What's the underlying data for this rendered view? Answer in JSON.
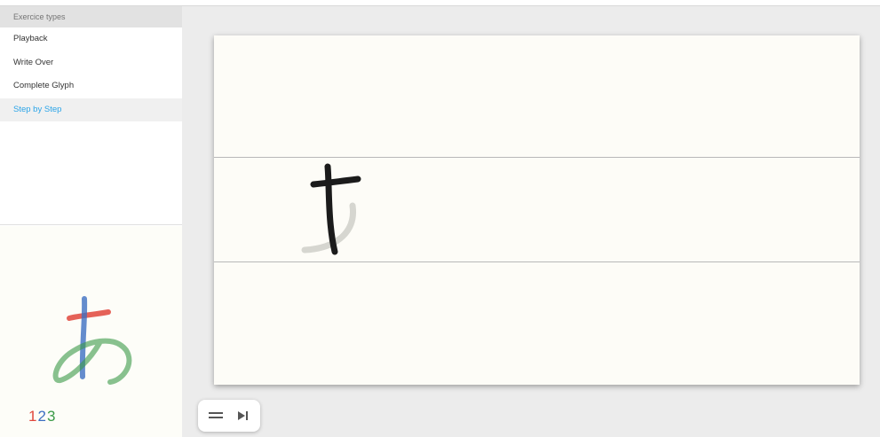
{
  "sidebar": {
    "header": "Exercice types",
    "items": [
      {
        "label": "Playback",
        "active": false
      },
      {
        "label": "Write Over",
        "active": false
      },
      {
        "label": "Complete Glyph",
        "active": false
      },
      {
        "label": "Step by Step",
        "active": true
      }
    ],
    "active_color": "#2aa4e8"
  },
  "preview": {
    "stroke_numbers": [
      "1",
      "2",
      "3"
    ],
    "stroke_colors": [
      "#e0473c",
      "#3d6fc2",
      "#3a9a47"
    ]
  },
  "controls": {
    "buttons": [
      "menu-icon",
      "skip-next-icon"
    ]
  }
}
